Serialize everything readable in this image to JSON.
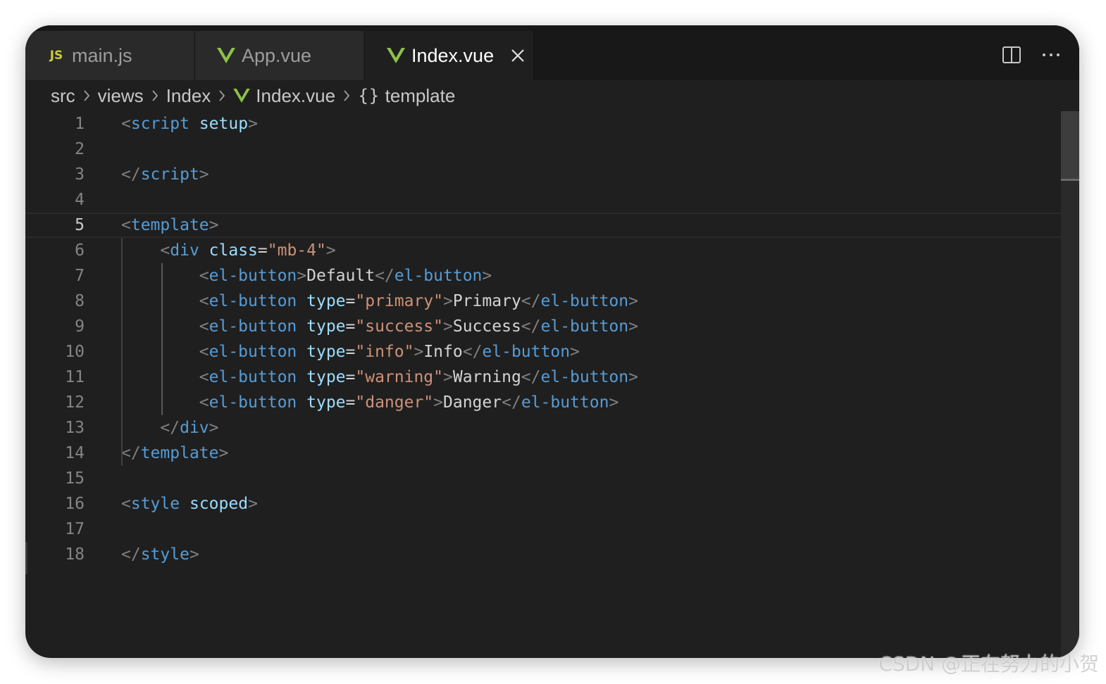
{
  "tabs": [
    {
      "label": "main.js",
      "icon": "js-icon",
      "icon_text": "JS",
      "active": false
    },
    {
      "label": "App.vue",
      "icon": "vue-icon",
      "active": false
    },
    {
      "label": "Index.vue",
      "icon": "vue-icon",
      "active": true
    }
  ],
  "actions": {
    "split_editor": "split-editor-icon",
    "more": "more-actions-icon"
  },
  "breadcrumb": [
    {
      "label": "src"
    },
    {
      "label": "views"
    },
    {
      "label": "Index"
    },
    {
      "label": "Index.vue",
      "icon": "vue-icon"
    },
    {
      "label": "template",
      "icon": "braces-icon",
      "icon_text": "{}"
    }
  ],
  "editor": {
    "current_line": 5,
    "lines": [
      {
        "n": "1",
        "tokens": [
          {
            "c": "punc",
            "t": "<"
          },
          {
            "c": "tag",
            "t": "script"
          },
          {
            "c": "text",
            "t": " "
          },
          {
            "c": "attr",
            "t": "setup"
          },
          {
            "c": "punc",
            "t": ">"
          }
        ]
      },
      {
        "n": "2",
        "tokens": []
      },
      {
        "n": "3",
        "tokens": [
          {
            "c": "punc",
            "t": "</"
          },
          {
            "c": "tag",
            "t": "script"
          },
          {
            "c": "punc",
            "t": ">"
          }
        ]
      },
      {
        "n": "4",
        "tokens": []
      },
      {
        "n": "5",
        "tokens": [
          {
            "c": "punc",
            "t": "<"
          },
          {
            "c": "tag",
            "t": "template"
          },
          {
            "c": "punc",
            "t": ">"
          }
        ]
      },
      {
        "n": "6",
        "tokens": [
          {
            "c": "text",
            "t": "    "
          },
          {
            "c": "punc",
            "t": "<"
          },
          {
            "c": "tag",
            "t": "div"
          },
          {
            "c": "text",
            "t": " "
          },
          {
            "c": "attr",
            "t": "class"
          },
          {
            "c": "text",
            "t": "="
          },
          {
            "c": "str",
            "t": "\"mb-4\""
          },
          {
            "c": "punc",
            "t": ">"
          }
        ]
      },
      {
        "n": "7",
        "tokens": [
          {
            "c": "text",
            "t": "        "
          },
          {
            "c": "punc",
            "t": "<"
          },
          {
            "c": "tag",
            "t": "el-button"
          },
          {
            "c": "punc",
            "t": ">"
          },
          {
            "c": "text",
            "t": "Default"
          },
          {
            "c": "punc",
            "t": "</"
          },
          {
            "c": "tag",
            "t": "el-button"
          },
          {
            "c": "punc",
            "t": ">"
          }
        ]
      },
      {
        "n": "8",
        "tokens": [
          {
            "c": "text",
            "t": "        "
          },
          {
            "c": "punc",
            "t": "<"
          },
          {
            "c": "tag",
            "t": "el-button"
          },
          {
            "c": "text",
            "t": " "
          },
          {
            "c": "attr",
            "t": "type"
          },
          {
            "c": "text",
            "t": "="
          },
          {
            "c": "str",
            "t": "\"primary\""
          },
          {
            "c": "punc",
            "t": ">"
          },
          {
            "c": "text",
            "t": "Primary"
          },
          {
            "c": "punc",
            "t": "</"
          },
          {
            "c": "tag",
            "t": "el-button"
          },
          {
            "c": "punc",
            "t": ">"
          }
        ]
      },
      {
        "n": "9",
        "tokens": [
          {
            "c": "text",
            "t": "        "
          },
          {
            "c": "punc",
            "t": "<"
          },
          {
            "c": "tag",
            "t": "el-button"
          },
          {
            "c": "text",
            "t": " "
          },
          {
            "c": "attr",
            "t": "type"
          },
          {
            "c": "text",
            "t": "="
          },
          {
            "c": "str",
            "t": "\"success\""
          },
          {
            "c": "punc",
            "t": ">"
          },
          {
            "c": "text",
            "t": "Success"
          },
          {
            "c": "punc",
            "t": "</"
          },
          {
            "c": "tag",
            "t": "el-button"
          },
          {
            "c": "punc",
            "t": ">"
          }
        ]
      },
      {
        "n": "10",
        "tokens": [
          {
            "c": "text",
            "t": "        "
          },
          {
            "c": "punc",
            "t": "<"
          },
          {
            "c": "tag",
            "t": "el-button"
          },
          {
            "c": "text",
            "t": " "
          },
          {
            "c": "attr",
            "t": "type"
          },
          {
            "c": "text",
            "t": "="
          },
          {
            "c": "str",
            "t": "\"info\""
          },
          {
            "c": "punc",
            "t": ">"
          },
          {
            "c": "text",
            "t": "Info"
          },
          {
            "c": "punc",
            "t": "</"
          },
          {
            "c": "tag",
            "t": "el-button"
          },
          {
            "c": "punc",
            "t": ">"
          }
        ]
      },
      {
        "n": "11",
        "tokens": [
          {
            "c": "text",
            "t": "        "
          },
          {
            "c": "punc",
            "t": "<"
          },
          {
            "c": "tag",
            "t": "el-button"
          },
          {
            "c": "text",
            "t": " "
          },
          {
            "c": "attr",
            "t": "type"
          },
          {
            "c": "text",
            "t": "="
          },
          {
            "c": "str",
            "t": "\"warning\""
          },
          {
            "c": "punc",
            "t": ">"
          },
          {
            "c": "text",
            "t": "Warning"
          },
          {
            "c": "punc",
            "t": "</"
          },
          {
            "c": "tag",
            "t": "el-button"
          },
          {
            "c": "punc",
            "t": ">"
          }
        ]
      },
      {
        "n": "12",
        "tokens": [
          {
            "c": "text",
            "t": "        "
          },
          {
            "c": "punc",
            "t": "<"
          },
          {
            "c": "tag",
            "t": "el-button"
          },
          {
            "c": "text",
            "t": " "
          },
          {
            "c": "attr",
            "t": "type"
          },
          {
            "c": "text",
            "t": "="
          },
          {
            "c": "str",
            "t": "\"danger\""
          },
          {
            "c": "punc",
            "t": ">"
          },
          {
            "c": "text",
            "t": "Danger"
          },
          {
            "c": "punc",
            "t": "</"
          },
          {
            "c": "tag",
            "t": "el-button"
          },
          {
            "c": "punc",
            "t": ">"
          }
        ]
      },
      {
        "n": "13",
        "tokens": [
          {
            "c": "text",
            "t": "    "
          },
          {
            "c": "punc",
            "t": "</"
          },
          {
            "c": "tag",
            "t": "div"
          },
          {
            "c": "punc",
            "t": ">"
          }
        ]
      },
      {
        "n": "14",
        "tokens": [
          {
            "c": "punc",
            "t": "</"
          },
          {
            "c": "tag",
            "t": "template"
          },
          {
            "c": "punc",
            "t": ">"
          }
        ]
      },
      {
        "n": "15",
        "tokens": []
      },
      {
        "n": "16",
        "tokens": [
          {
            "c": "punc",
            "t": "<"
          },
          {
            "c": "tag",
            "t": "style"
          },
          {
            "c": "text",
            "t": " "
          },
          {
            "c": "attr",
            "t": "scoped"
          },
          {
            "c": "punc",
            "t": ">"
          }
        ]
      },
      {
        "n": "17",
        "tokens": []
      },
      {
        "n": "18",
        "tokens": [
          {
            "c": "punc",
            "t": "</"
          },
          {
            "c": "tag",
            "t": "style"
          },
          {
            "c": "punc",
            "t": ">"
          }
        ]
      }
    ]
  },
  "colors": {
    "editor_bg": "#1f1f1f",
    "tab_bg": "#2a2a2a",
    "vue_green": "#8dc149",
    "tag_blue": "#569cd6",
    "attr_blue": "#9cdcfe",
    "string_orange": "#ce9178"
  },
  "watermark": "CSDN @正在努力的小贺"
}
